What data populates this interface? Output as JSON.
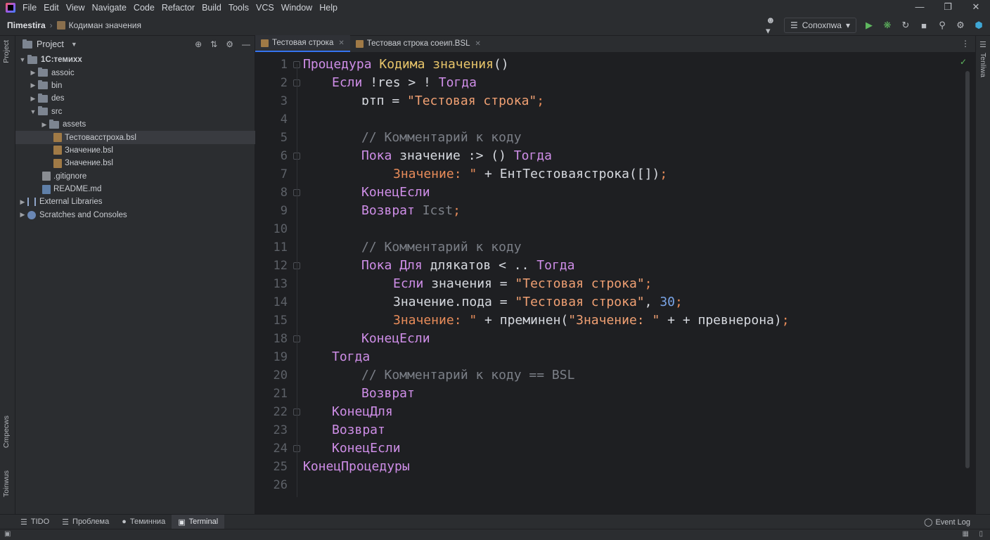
{
  "menu": [
    "File",
    "Edit",
    "View",
    "Navigate",
    "Code",
    "Refactor",
    "Build",
    "Tools",
    "VCS",
    "Window",
    "Help"
  ],
  "breadcrumb": {
    "project": "Пimestira",
    "file": "Кодиман значения"
  },
  "run_config": {
    "label": "Сопохпwa"
  },
  "project_panel": {
    "title": "Project",
    "root": "1С:темихх",
    "items": [
      {
        "label": "assoic",
        "kind": "folder",
        "depth": 1
      },
      {
        "label": "bin",
        "kind": "folder",
        "depth": 1
      },
      {
        "label": "des",
        "kind": "folder",
        "depth": 1
      },
      {
        "label": "src",
        "kind": "folder",
        "depth": 1
      },
      {
        "label": "assets",
        "kind": "folder",
        "depth": 2
      },
      {
        "label": "Тестоваcстрoха.bsl",
        "kind": "file",
        "depth": 2
      },
      {
        "label": "Значение.bsl",
        "kind": "file",
        "depth": 2
      },
      {
        "label": "Значение.bsl",
        "kind": "file",
        "depth": 2
      },
      {
        "label": ".gitignore",
        "kind": "git",
        "depth": 1
      },
      {
        "label": "README.md",
        "kind": "md",
        "depth": 1
      },
      {
        "label": "External Libraries",
        "kind": "lib",
        "depth": 0
      },
      {
        "label": "Scratches and Consoles",
        "kind": "scratch",
        "depth": 0
      }
    ]
  },
  "left_strip": {
    "project_tab": "Project",
    "structure_tab": "Cmpecws",
    "favorites_tab": "Toinwus"
  },
  "right_strip": {
    "tab": "Tenliwa"
  },
  "tabs": [
    {
      "label": "Тестовая строка"
    },
    {
      "label": "Тестовая строка соеип.BSL"
    }
  ],
  "line_numbers": [
    "1",
    "2",
    "3",
    "4",
    "5",
    "6",
    "7",
    "8",
    "9",
    "10",
    "11",
    "12",
    "13",
    "14",
    "15",
    "18",
    "19",
    "20",
    "21",
    "22",
    "23",
    "24",
    "25",
    "26"
  ],
  "code": {
    "l1": {
      "a": "Процедура",
      "b": "Кодима",
      "c": "значения",
      "d": "()"
    },
    "l2": {
      "a": "Если",
      "b": "!res > !",
      "c": "Тогда"
    },
    "l3": {
      "a": "ɒтп = ",
      "b": "\"Тестовая строка\"",
      "c": ";"
    },
    "l5": "// Комментарий к коду",
    "l6": {
      "a": "Пока",
      "b": "значение :> ()",
      "c": "Тогда"
    },
    "l7": {
      "a": "Значение: \"",
      "b": " + ",
      "c": "ЕнтТестоваястрока([])",
      "d": ";"
    },
    "l8": "КонецЕсли",
    "l9": {
      "a": "Возврат",
      "b": "Icst",
      "c": ";"
    },
    "l11": "// Комментарий к коду",
    "l12": {
      "a": "Пока",
      "b": "Для",
      "c": "длякатов < ..",
      "d": "Тогда"
    },
    "l13": {
      "a": "Если",
      "b": "значения = ",
      "c": "\"Тестовая строка\"",
      "d": ";"
    },
    "l14": {
      "a": "Значение.пода = ",
      "b": "\"Тестовая строка\"",
      "c": ", ",
      "d": "30",
      "e": ";"
    },
    "l15": {
      "a": "Значение: \"",
      "b": " + преминен(",
      "c": "\"Значение: \"",
      "d": " + + превнерона)",
      "e": ";"
    },
    "l18": "КонецЕсли",
    "l19": "Тогда",
    "l20": "// Комментарий к коду == BSL",
    "l21": "Возврат",
    "l22": "КонецДля",
    "l23": "Возврат",
    "l24": "КонецЕсли",
    "l25": "КонецПроцедуры"
  },
  "bottom_tabs": [
    "TIDO",
    "Проблема",
    "Теминниа",
    "Terminal"
  ],
  "event_log": "Event Log",
  "colors": {
    "keyword": "#cf8ee8",
    "function": "#e8c56a",
    "string": "#f0a073",
    "comment": "#7b7f87",
    "number": "#7aa4e6",
    "accent": "#3574f0"
  }
}
